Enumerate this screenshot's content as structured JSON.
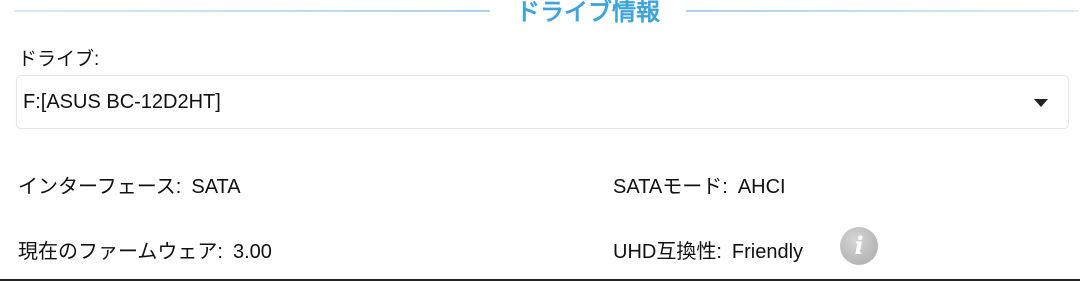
{
  "section": {
    "title": "ドライブ情報"
  },
  "drive": {
    "label": "ドライブ:",
    "selected": "F:[ASUS BC-12D2HT]"
  },
  "info": {
    "interface_label": "インターフェース:",
    "interface_value": "SATA",
    "sata_mode_label": "SATAモード:",
    "sata_mode_value": "AHCI",
    "firmware_label": "現在のファームウェア:",
    "firmware_value": "3.00",
    "uhd_label": "UHD互換性:",
    "uhd_value": "Friendly",
    "info_icon_glyph": "i"
  },
  "colors": {
    "accent": "#3fa3dc",
    "icon_gray": "#b4b4b4"
  },
  "icons": {
    "dropdown": "chevron-down-icon",
    "info": "info-icon"
  }
}
